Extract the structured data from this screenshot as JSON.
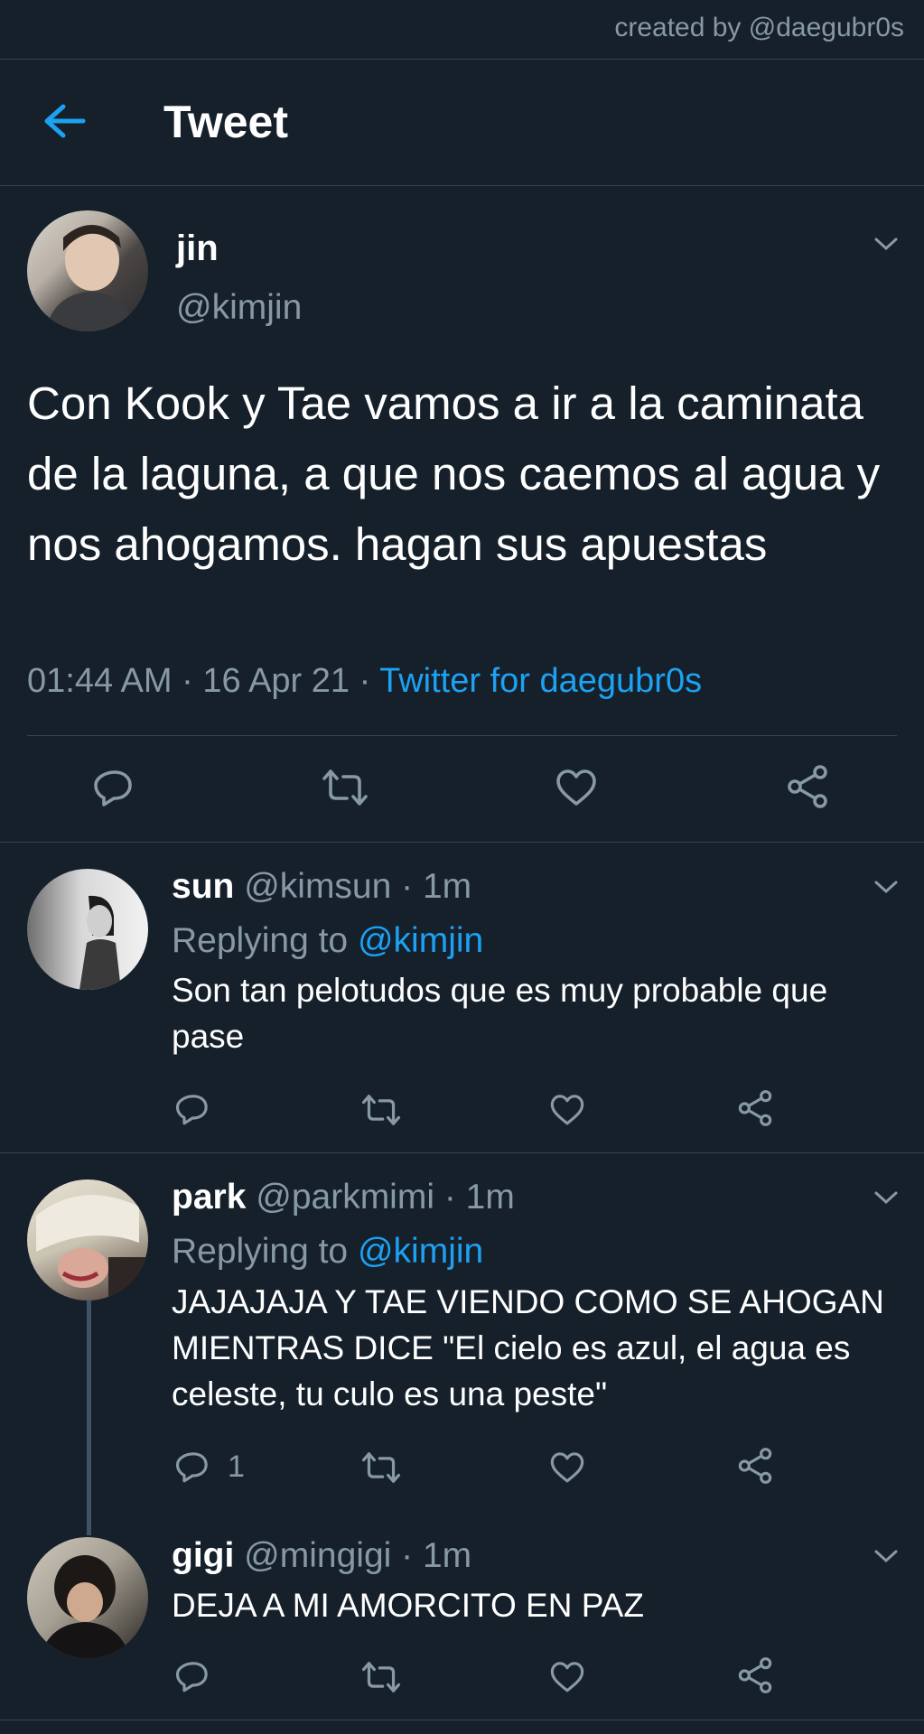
{
  "credit": "created by @daegubr0s",
  "header": {
    "title": "Tweet"
  },
  "main_tweet": {
    "name": "jin",
    "handle": "@kimjin",
    "text": "Con Kook y Tae vamos a ir a la caminata de la laguna, a que nos caemos al agua y nos ahogamos. hagan sus apuestas",
    "time": "01:44 AM",
    "dot1": " · ",
    "date": "16 Apr 21",
    "dot2": " · ",
    "source": "Twitter for daegubr0s"
  },
  "replies": [
    {
      "name": "sun",
      "handle": "@kimsun",
      "time": "· 1m",
      "replying_label": "Replying to",
      "replying_to": "@kimjin",
      "text": "Son tan pelotudos que es muy probable que pase"
    },
    {
      "name": "park",
      "handle": "@parkmimi",
      "time": "· 1m",
      "replying_label": "Replying to",
      "replying_to": "@kimjin",
      "text": "JAJAJAJA Y TAE VIENDO COMO SE AHOGAN MIENTRAS DICE \"El cielo es azul, el agua es celeste, tu culo es una peste\"",
      "reply_count": "1"
    },
    {
      "name": "gigi",
      "handle": "@mingigi",
      "time": "· 1m",
      "text": "DEJA A MI AMORCITO EN PAZ"
    }
  ],
  "colors": {
    "background": "#15202b",
    "accent": "#1da1f2",
    "muted": "#8899a6",
    "divider": "#38444d"
  }
}
